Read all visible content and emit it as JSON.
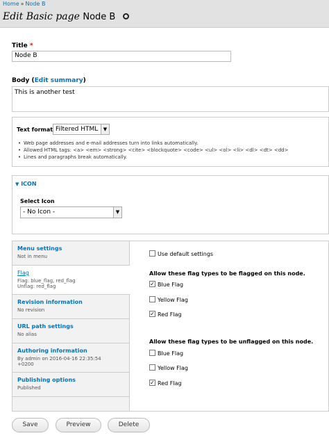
{
  "breadcrumb": {
    "home": "Home",
    "sep": "»",
    "current": "Node B"
  },
  "page": {
    "title_prefix": "Edit Basic page",
    "title_node": "Node B"
  },
  "title_field": {
    "label": "Title",
    "required": "*",
    "value": "Node B"
  },
  "body_field": {
    "label": "Body",
    "link_open": " (",
    "summary_link": "Edit summary",
    "link_close": ")",
    "value": "This is another test"
  },
  "text_format": {
    "label": "Text format",
    "selected": "Filtered HTML",
    "tips": [
      "Web page addresses and e-mail addresses turn into links automatically.",
      "Allowed HTML tags: <a> <em> <strong> <cite> <blockquote> <code> <ul> <ol> <li> <dl> <dt> <dd>",
      "Lines and paragraphs break automatically."
    ]
  },
  "icon_fieldset": {
    "legend": "ICON",
    "select_label": "Select Icon",
    "selected": "- No Icon -"
  },
  "vtabs": [
    {
      "title": "Menu settings",
      "summary": "Not in menu"
    },
    {
      "title": "Flag",
      "summary": "Flag: blue_flag, red_flag",
      "summary2": "Unflag: red_flag"
    },
    {
      "title": "Revision information",
      "summary": "No revision"
    },
    {
      "title": "URL path settings",
      "summary": "No alias"
    },
    {
      "title": "Authoring information",
      "summary": "By admin on 2016-04-16 22:35:54",
      "summary2": "+0200"
    },
    {
      "title": "Publishing options",
      "summary": "Published"
    }
  ],
  "flag_pane": {
    "use_default": "Use default settings",
    "flag_heading": "Allow these flag types to be flagged on this node.",
    "flag_options": [
      {
        "label": "Blue Flag",
        "checked": true
      },
      {
        "label": "Yellow Flag",
        "checked": false
      },
      {
        "label": "Red Flag",
        "checked": true
      }
    ],
    "unflag_heading": "Allow these flag types to be unflagged on this node.",
    "unflag_options": [
      {
        "label": "Blue Flag",
        "checked": false
      },
      {
        "label": "Yellow Flag",
        "checked": false
      },
      {
        "label": "Red Flag",
        "checked": true
      }
    ],
    "check_mark": "✓"
  },
  "actions": {
    "save": "Save",
    "preview": "Preview",
    "delete": "Delete"
  },
  "icons": {
    "gear": "gear-icon",
    "collapse": "triangle-down-icon",
    "dropdown": "chevron-down-icon"
  }
}
